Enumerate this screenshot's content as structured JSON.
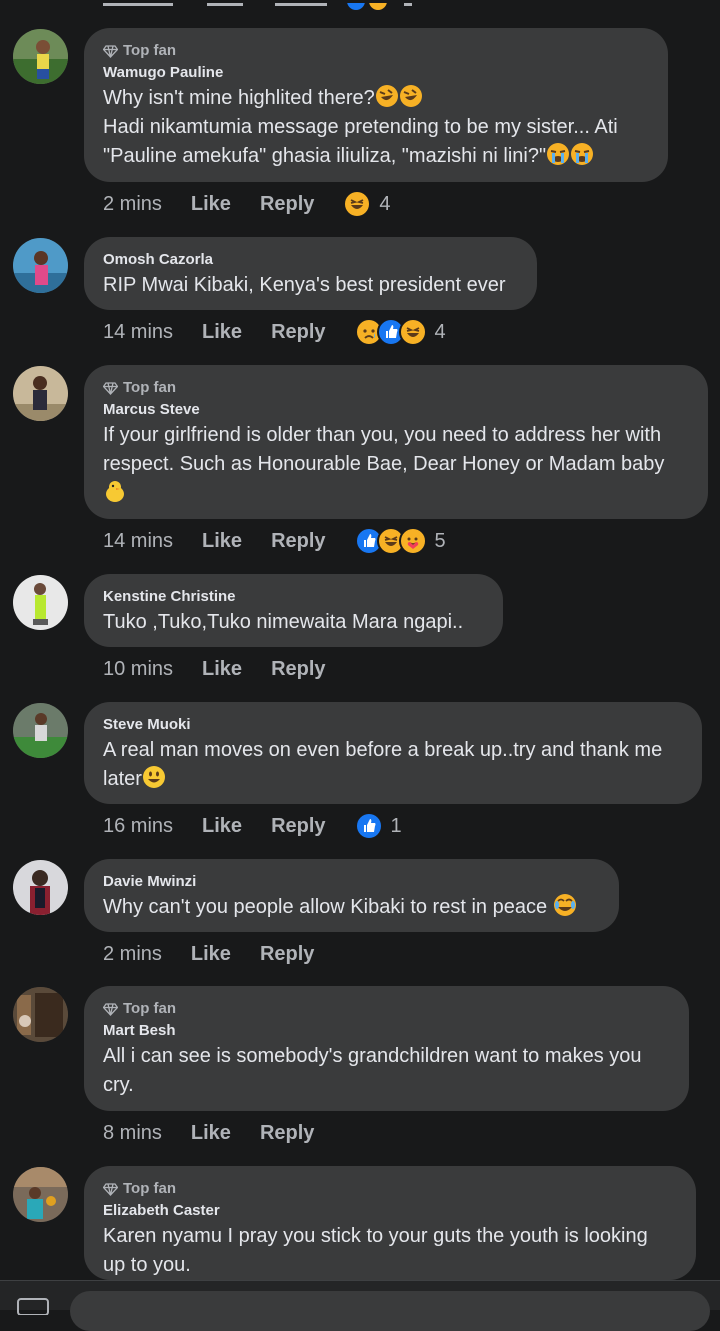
{
  "colors": {
    "bg": "#18191a",
    "bubble": "#3a3b3c",
    "text": "#e4e6eb",
    "muted": "#b0b3b8",
    "like": "#1877f2",
    "haha": "#f7b125"
  },
  "actions": {
    "like": "Like",
    "reply": "Reply"
  },
  "top_fan_label": "Top fan",
  "comments": [
    {
      "top_fan": true,
      "name": "Wamugo Pauline",
      "lines": [
        "Why isn't mine highlited there?",
        "Hadi nikamtumia message pretending to be my sister... Ati",
        "\"Pauline amekufa\" ghasia iliuliza, \"mazishi ni lini?\""
      ],
      "emojis": [
        "rofl",
        "rofl",
        "sob",
        "sob"
      ],
      "time": "2 mins",
      "reactions": [
        "haha"
      ],
      "reaction_count": "4"
    },
    {
      "top_fan": false,
      "name": "Omosh Cazorla",
      "lines": [
        "RIP Mwai Kibaki, Kenya's best president ever"
      ],
      "time": "14 mins",
      "reactions": [
        "sad",
        "like",
        "haha"
      ],
      "reaction_count": "4"
    },
    {
      "top_fan": true,
      "name": "Marcus Steve",
      "lines": [
        "If your girlfriend is older than you, you need to address her with",
        "respect. Such as Honourable Bae, Dear Honey or Madam baby"
      ],
      "emojis": [
        "chick"
      ],
      "time": "14 mins",
      "reactions": [
        "like",
        "haha",
        "care"
      ],
      "reaction_count": "5"
    },
    {
      "top_fan": false,
      "name": "Kenstine Christine",
      "lines": [
        "Tuko ,Tuko,Tuko nimewaita Mara ngapi.."
      ],
      "time": "10 mins",
      "reactions": [],
      "reaction_count": ""
    },
    {
      "top_fan": false,
      "name": "Steve Muoki",
      "lines": [
        "A real man moves on even before a break up..try and thank me",
        "later"
      ],
      "emojis": [
        "smile"
      ],
      "time": "16 mins",
      "reactions": [
        "like"
      ],
      "reaction_count": "1"
    },
    {
      "top_fan": false,
      "name": "Davie Mwinzi",
      "lines": [
        "Why can't you people allow Kibaki to rest in peace"
      ],
      "emojis": [
        "joy"
      ],
      "time": "2 mins",
      "reactions": [],
      "reaction_count": ""
    },
    {
      "top_fan": true,
      "name": "Mart Besh",
      "lines": [
        "All i can see is somebody's grandchildren want to makes you",
        "cry."
      ],
      "time": "8 mins",
      "reactions": [],
      "reaction_count": ""
    },
    {
      "top_fan": true,
      "name": "Elizabeth Caster",
      "lines": [
        "Karen nyamu I pray you stick to your guts the youth is looking",
        "up to you."
      ],
      "time": "",
      "reactions": [],
      "reaction_count": ""
    }
  ]
}
